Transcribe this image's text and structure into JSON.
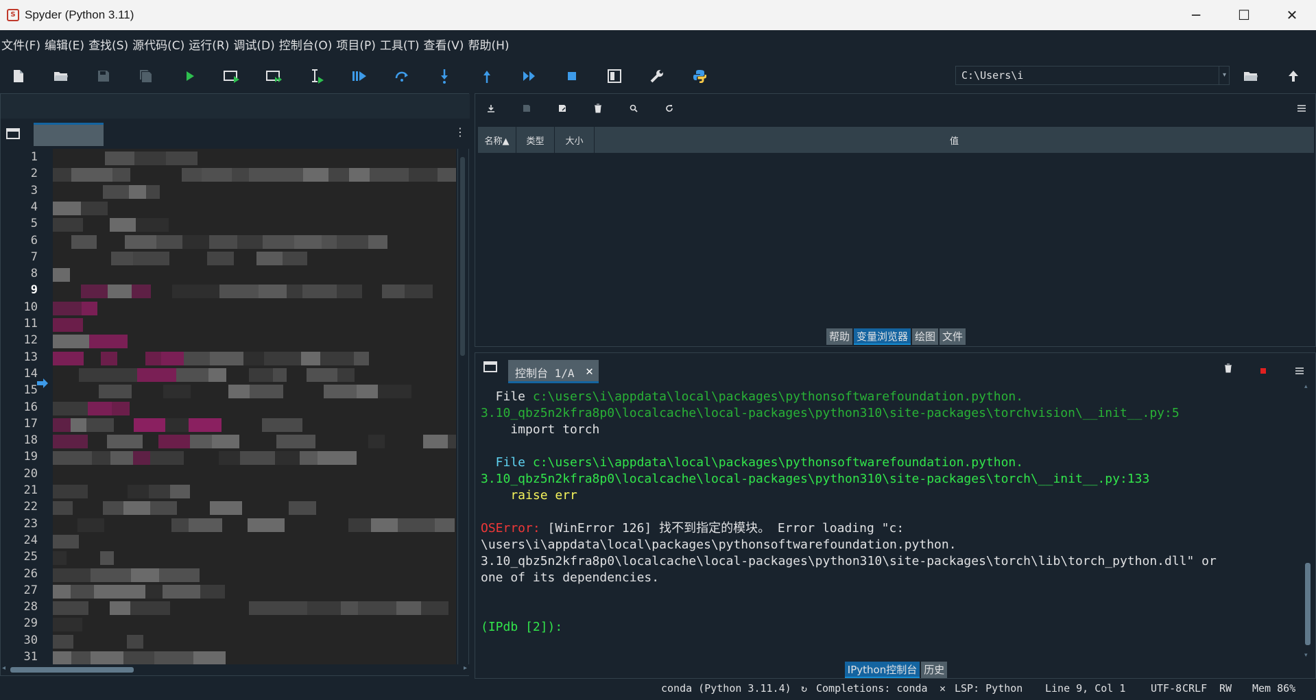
{
  "window": {
    "title": "Spyder (Python 3.11)",
    "icon": "spyder-icon",
    "controls": {
      "minimize": "─",
      "maximize": "☐",
      "close": "✕"
    }
  },
  "menu": [
    "文件(F)",
    "编辑(E)",
    "查找(S)",
    "源代码(C)",
    "运行(R)",
    "调试(D)",
    "控制台(O)",
    "项目(P)",
    "工具(T)",
    "查看(V)",
    "帮助(H)"
  ],
  "toolbar": {
    "buttons": [
      "new-file",
      "open-file",
      "save-file",
      "save-all",
      "run",
      "run-cell",
      "run-cell-advance",
      "run-selection",
      "debug",
      "step",
      "step-into",
      "step-return",
      "continue",
      "stop",
      "maximize-pane",
      "preferences",
      "python-path"
    ],
    "working_dir": "C:\\Users\\i"
  },
  "editor": {
    "line_numbers": [
      "1",
      "2",
      "3",
      "4",
      "5",
      "6",
      "7",
      "8",
      "9",
      "10",
      "11",
      "12",
      "13",
      "14",
      "15",
      "16",
      "17",
      "18",
      "19",
      "20",
      "21",
      "22",
      "23",
      "24",
      "25",
      "26",
      "27",
      "28",
      "29",
      "30",
      "31"
    ],
    "current_line": "9"
  },
  "variable_explorer": {
    "columns": [
      "名称▲",
      "类型",
      "大小",
      "值"
    ],
    "tabs": [
      "帮助",
      "变量浏览器",
      "绘图",
      "文件"
    ],
    "active_tab": "变量浏览器"
  },
  "console": {
    "tab_label": "控制台 1/A",
    "lines": [
      {
        "parts": [
          {
            "t": "  File ",
            "c": "c-white"
          },
          {
            "t": "c:\\users\\i\\appdata\\local\\packages\\pythonsoftwarefoundation.python.",
            "c": "c-green"
          }
        ]
      },
      {
        "parts": [
          {
            "t": "3.10_qbz5n2kfra8p0\\localcache\\local-packages\\python310\\site-packages\\torchvision\\__init__.py:5",
            "c": "c-green"
          }
        ]
      },
      {
        "parts": [
          {
            "t": "    import torch",
            "c": "c-white"
          }
        ]
      },
      {
        "parts": [
          {
            "t": "",
            "c": "c-white"
          }
        ]
      },
      {
        "parts": [
          {
            "t": "  File ",
            "c": "c-cyan"
          },
          {
            "t": "c:\\users\\i\\appdata\\local\\packages\\pythonsoftwarefoundation.python.",
            "c": "c-bright"
          }
        ]
      },
      {
        "parts": [
          {
            "t": "3.10_qbz5n2kfra8p0\\localcache\\local-packages\\python310\\site-packages\\torch\\__init__.py:133",
            "c": "c-bright"
          }
        ]
      },
      {
        "parts": [
          {
            "t": "    raise err",
            "c": "c-yellow"
          }
        ]
      },
      {
        "parts": [
          {
            "t": "",
            "c": "c-white"
          }
        ]
      },
      {
        "parts": [
          {
            "t": "OSError: ",
            "c": "c-red"
          },
          {
            "t": "[WinError 126] 找不到指定的模块。 Error loading \"c:",
            "c": "c-white"
          }
        ]
      },
      {
        "parts": [
          {
            "t": "\\users\\i\\appdata\\local\\packages\\pythonsoftwarefoundation.python.",
            "c": "c-white"
          }
        ]
      },
      {
        "parts": [
          {
            "t": "3.10_qbz5n2kfra8p0\\localcache\\local-packages\\python310\\site-packages\\torch\\lib\\torch_python.dll\" or",
            "c": "c-white"
          }
        ]
      },
      {
        "parts": [
          {
            "t": "one of its dependencies.",
            "c": "c-white"
          }
        ]
      },
      {
        "parts": [
          {
            "t": "",
            "c": "c-white"
          }
        ]
      },
      {
        "parts": [
          {
            "t": "",
            "c": "c-white"
          }
        ]
      },
      {
        "parts": [
          {
            "t": "(IPdb [2]):",
            "c": "c-bright"
          }
        ]
      }
    ],
    "tabs": [
      "IPython控制台",
      "历史"
    ],
    "active_tab": "IPython控制台"
  },
  "status": {
    "env": "conda (Python 3.11.4)",
    "completions": "Completions: conda",
    "lsp": "LSP: Python",
    "position": "Line 9, Col 1",
    "encoding": "UTF-8",
    "eol": "CRLF",
    "mode": "RW",
    "mem": "Mem 86%"
  },
  "colors": {
    "background": "#19232d",
    "border": "#32414b",
    "accent": "#1464a0",
    "text": "#e0e1e3"
  }
}
